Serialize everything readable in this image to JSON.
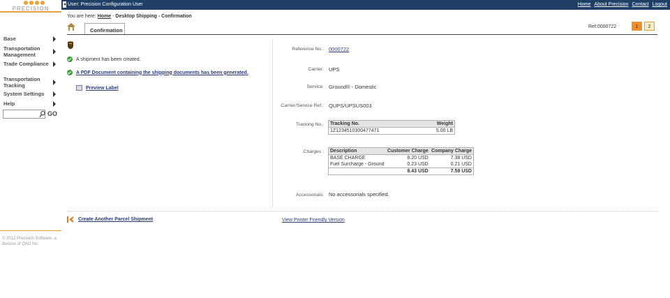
{
  "app": {
    "logo_text": "PRECISION",
    "logo_subtext": "SOFTWARE",
    "user_label": "User: Precision Configuration User",
    "top_links": [
      "Home",
      "About Precision",
      "Contact",
      "Logout"
    ]
  },
  "sidebar": {
    "items": [
      {
        "label": "Base"
      },
      {
        "label": "Transportation Management"
      },
      {
        "label": "Trade Compliance"
      },
      {
        "label": "Transportation Tracking"
      },
      {
        "label": "System Settings"
      },
      {
        "label": "Help"
      }
    ],
    "search_value": "",
    "go_label": "GO",
    "footer": "© 2012 Precision Software, a division of QAD Inc."
  },
  "breadcrumb": {
    "prefix": "You are here:",
    "home": "Home",
    "separator": " - ",
    "page1": "Desktop Shipping",
    "page2": "Confirmation"
  },
  "tab": {
    "label": "Confirmation"
  },
  "ref_top": "Ref:0000722",
  "pagination": [
    "1",
    "2"
  ],
  "messages": {
    "created": "A shipment has been created.",
    "pdf": "A PDF Document containing the shipping documents has been generated.",
    "preview": "Preview Label"
  },
  "details": {
    "reference_label": "Reference No.:",
    "reference_value": "0000722",
    "carrier_label": "Carrier:",
    "carrier_value": "UPS",
    "service_label": "Service:",
    "service_value": "Ground® - Domestic",
    "csref_label": "Carrier/Service Ref.:",
    "csref_value": "QUPS/UPSUS003",
    "tracking_label": "Tracking No.:",
    "charges_label": "Charges :",
    "accessorials_label": "Accessorials:",
    "accessorials_value": "No accessorials specified."
  },
  "tracking_table": {
    "headers": [
      "Tracking No.",
      "Weight"
    ],
    "rows": [
      [
        "1Z1234510300477471",
        "5.00 LB"
      ]
    ]
  },
  "charges_table": {
    "headers": [
      "Description",
      "Customer Charge",
      "Company Charge"
    ],
    "rows": [
      [
        "BASE CHARGE",
        "8.20 USD",
        "7.38 USD"
      ],
      [
        "Fuel Surcharge - Ground",
        "0.23 USD",
        "0.21 USD"
      ]
    ],
    "totals": [
      "",
      "8.43 USD",
      "7.59 USD"
    ]
  },
  "footer_actions": {
    "create": "Create Another Parcel Shipment",
    "printer": "View Printer Friendly Version"
  },
  "colors": {
    "topbar": "#1f3f66",
    "accent": "#f08c2a",
    "link": "#2b3a7a",
    "success": "#3a9d3a"
  }
}
